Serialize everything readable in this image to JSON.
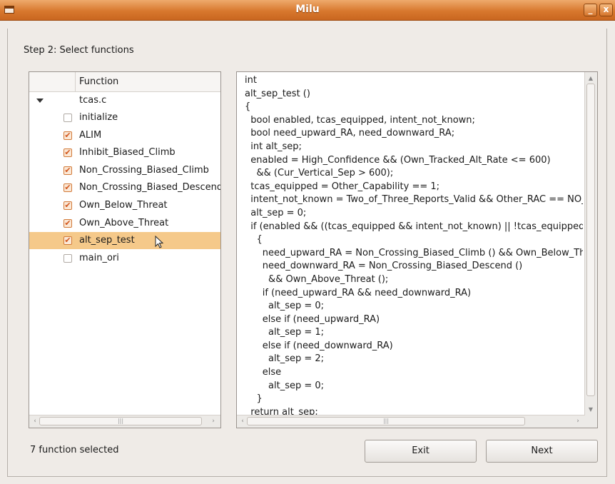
{
  "window": {
    "title": "Milu",
    "minimize_glyph": "_",
    "close_glyph": "x"
  },
  "step_label": "Step 2: Select functions",
  "function_list": {
    "header": "Function",
    "file": "tcas.c",
    "items": [
      {
        "label": "initialize",
        "checked": false
      },
      {
        "label": "ALIM",
        "checked": true
      },
      {
        "label": "Inhibit_Biased_Climb",
        "checked": true
      },
      {
        "label": "Non_Crossing_Biased_Climb",
        "checked": true
      },
      {
        "label": "Non_Crossing_Biased_Descend",
        "checked": true
      },
      {
        "label": "Own_Below_Threat",
        "checked": true
      },
      {
        "label": "Own_Above_Threat",
        "checked": true
      },
      {
        "label": "alt_sep_test",
        "checked": true,
        "selected": true
      },
      {
        "label": "main_ori",
        "checked": false
      }
    ]
  },
  "source_code": [
    "int",
    "alt_sep_test ()",
    "{",
    "  bool enabled, tcas_equipped, intent_not_known;",
    "  bool need_upward_RA, need_downward_RA;",
    "  int alt_sep;",
    "  enabled = High_Confidence && (Own_Tracked_Alt_Rate <= 600)",
    "    && (Cur_Vertical_Sep > 600);",
    "  tcas_equipped = Other_Capability == 1;",
    "  intent_not_known = Two_of_Three_Reports_Valid && Other_RAC == NO_INTENT;",
    "  alt_sep = 0;",
    "  if (enabled && ((tcas_equipped && intent_not_known) || !tcas_equipped))",
    "    {",
    "      need_upward_RA = Non_Crossing_Biased_Climb () && Own_Below_Threat ();",
    "      need_downward_RA = Non_Crossing_Biased_Descend ()",
    "        && Own_Above_Threat ();",
    "      if (need_upward_RA && need_downward_RA)",
    "        alt_sep = 0;",
    "      else if (need_upward_RA)",
    "        alt_sep = 1;",
    "      else if (need_downward_RA)",
    "        alt_sep = 2;",
    "      else",
    "        alt_sep = 0;",
    "    }",
    "  return alt_sep;"
  ],
  "status_text": "7 function selected",
  "buttons": {
    "exit": "Exit",
    "next": "Next"
  },
  "colors": {
    "titlebar": "#d8782e",
    "selection": "#f5c98a",
    "check": "#d2561c"
  }
}
